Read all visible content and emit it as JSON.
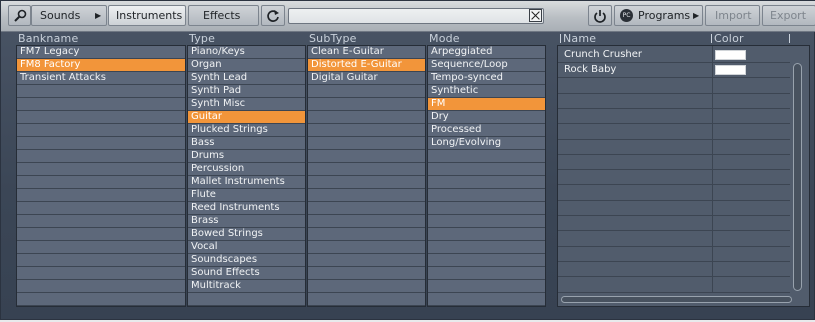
{
  "toolbar": {
    "sounds_label": "Sounds",
    "instruments_label": "Instruments",
    "effects_label": "Effects",
    "programs_label": "Programs",
    "import_label": "Import",
    "export_label": "Export",
    "search_value": ""
  },
  "columns": {
    "bankname": {
      "header": "Bankname",
      "items": [
        "FM7 Legacy",
        "FM8 Factory",
        "Transient Attacks"
      ],
      "selected": 1
    },
    "type": {
      "header": "Type",
      "items": [
        "Piano/Keys",
        "Organ",
        "Synth Lead",
        "Synth Pad",
        "Synth Misc",
        "Guitar",
        "Plucked Strings",
        "Bass",
        "Drums",
        "Percussion",
        "Mallet Instruments",
        "Flute",
        "Reed Instruments",
        "Brass",
        "Bowed Strings",
        "Vocal",
        "Soundscapes",
        "Sound Effects",
        "Multitrack"
      ],
      "selected": 5
    },
    "subtype": {
      "header": "SubType",
      "items": [
        "Clean E-Guitar",
        "Distorted E-Guitar",
        "Digital Guitar"
      ],
      "selected": 1
    },
    "mode": {
      "header": "Mode",
      "items": [
        "Arpeggiated",
        "Sequence/Loop",
        "Tempo-synced",
        "Synthetic",
        "FM",
        "Dry",
        "Processed",
        "Long/Evolving"
      ],
      "selected": 4
    }
  },
  "programs": {
    "name_header": "Name",
    "color_header": "Color",
    "rows": [
      {
        "name": "Crunch Crusher",
        "color": "#ffffff"
      },
      {
        "name": "Rock Baby",
        "color": "#ffffff"
      }
    ]
  }
}
